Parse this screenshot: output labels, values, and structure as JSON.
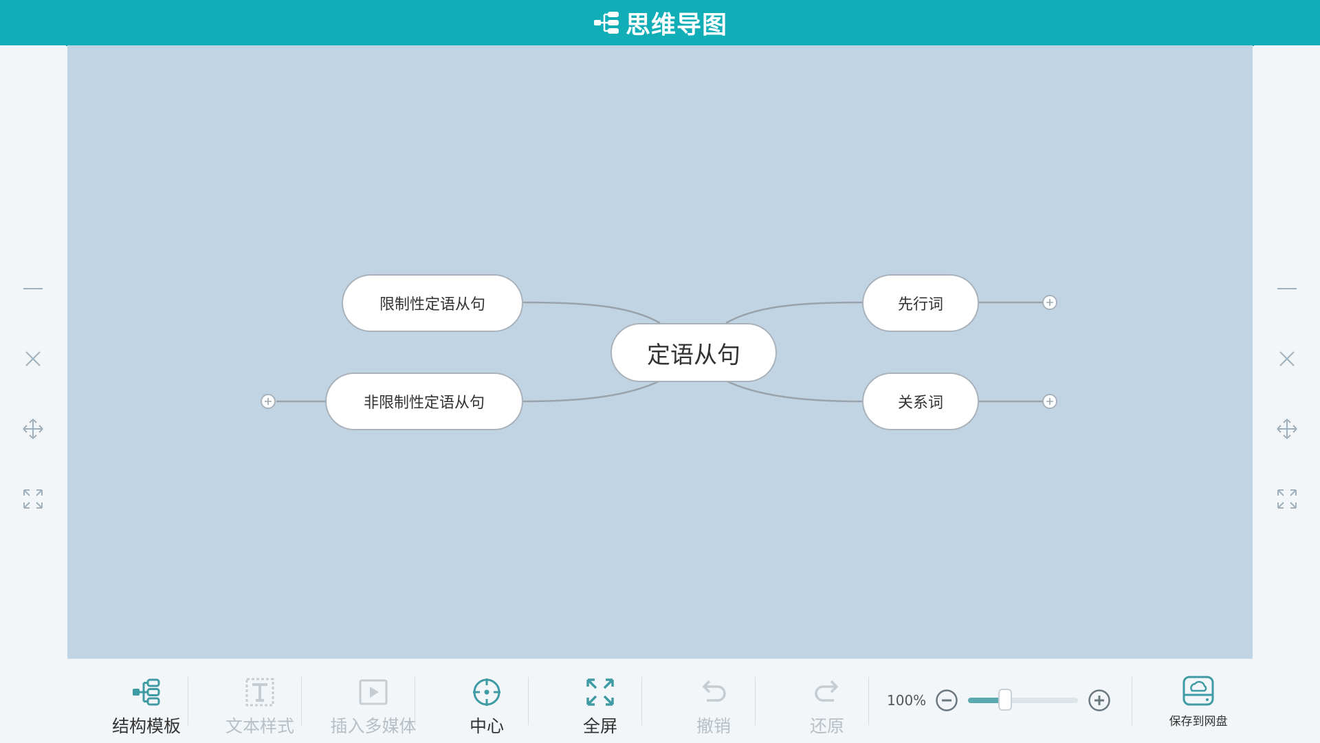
{
  "header": {
    "title": "思维导图"
  },
  "mindmap": {
    "center": "定语从句",
    "children": [
      {
        "label": "限制性定语从句"
      },
      {
        "label": "非限制性定语从句"
      },
      {
        "label": "先行词"
      },
      {
        "label": "关系词"
      }
    ]
  },
  "toolbar": {
    "structure": "结构模板",
    "text_style": "文本样式",
    "insert_media": "插入多媒体",
    "center": "中心",
    "fullscreen": "全屏",
    "undo": "撤销",
    "redo": "还原",
    "zoom_percent": "100%",
    "zoom_level": 0.34,
    "save": "保存到网盘"
  },
  "colors": {
    "header_bg": "#12aeb7",
    "canvas_bg": "#c0d4e4",
    "accent": "#1aa8b0"
  }
}
